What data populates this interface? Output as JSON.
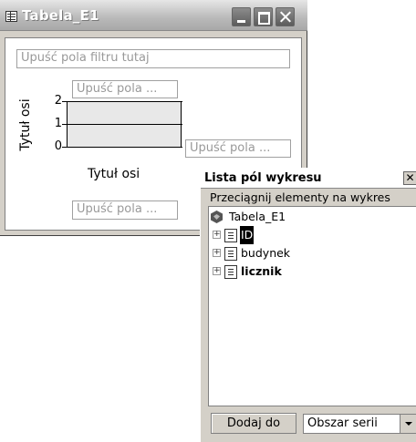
{
  "window": {
    "title": "Tabela_E1"
  },
  "chart": {
    "filter_drop": "Upuść pola filtru tutaj",
    "series_drop": "Upuść pola ...",
    "category_drop": "Upuść pola ...",
    "data_drop": "Upuść pola ...",
    "y_axis_title": "Tytuł osi",
    "x_axis_title": "Tytuł osi",
    "y_ticks": [
      "2",
      "1",
      "0"
    ]
  },
  "field_list": {
    "title": "Lista pól wykresu",
    "hint": "Przeciągnij elementy na wykres",
    "root": "Tabela_E1",
    "fields": [
      "ID",
      "budynek",
      "licznik"
    ],
    "add_button": "Dodaj do",
    "target_select": "Obszar serii"
  }
}
